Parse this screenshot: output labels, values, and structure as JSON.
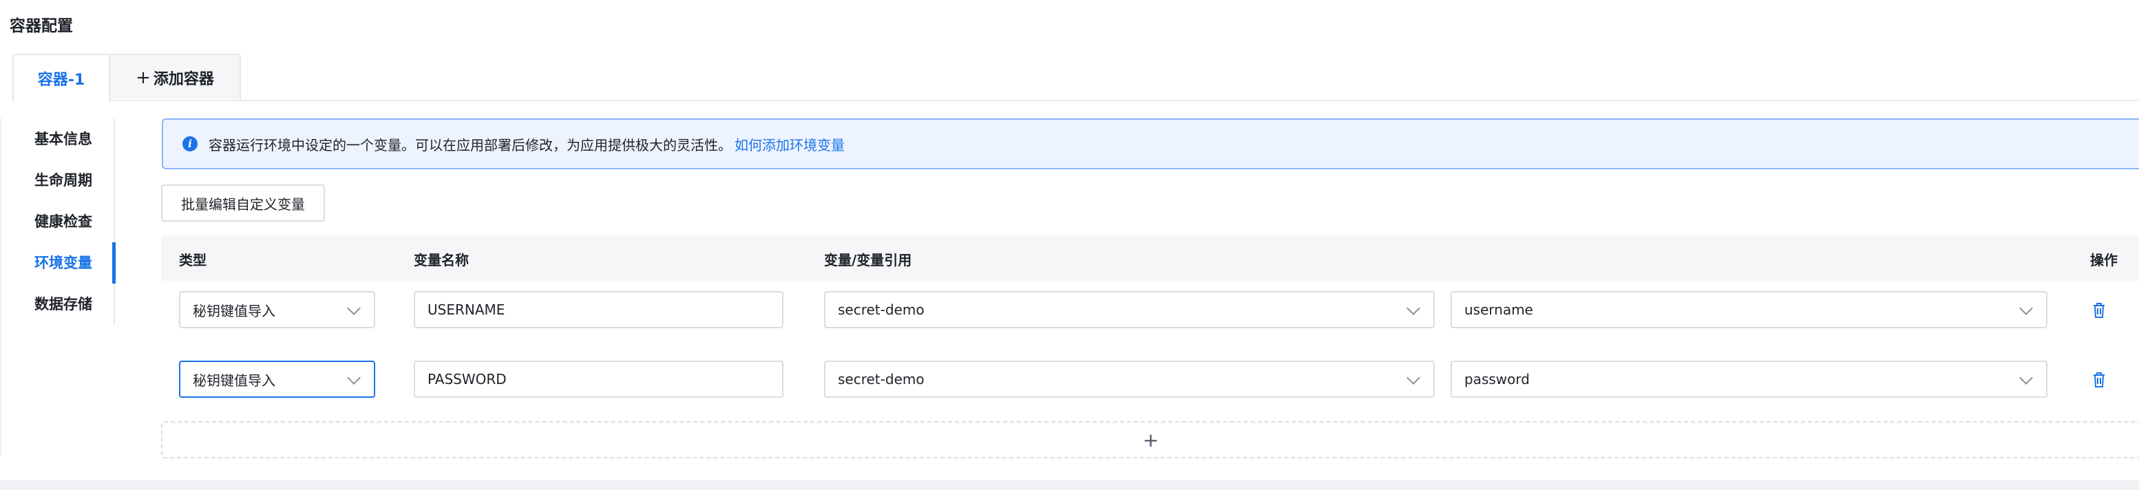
{
  "section_title": "容器配置",
  "tabs": [
    {
      "label": "容器-1"
    },
    {
      "plus": "+",
      "label": "添加容器"
    }
  ],
  "nav": {
    "items": [
      {
        "label": "基本信息"
      },
      {
        "label": "生命周期"
      },
      {
        "label": "健康检查"
      },
      {
        "label": "环境变量"
      },
      {
        "label": "数据存储"
      }
    ],
    "active_index": 3
  },
  "alert": {
    "icon": "info-icon",
    "text": "容器运行环境中设定的一个变量。可以在应用部署后修改，为应用提供极大的灵活性。",
    "link": "如何添加环境变量"
  },
  "batch_button": "批量编辑自定义变量",
  "table": {
    "headers": {
      "type": "类型",
      "name": "变量名称",
      "ref": "变量/变量引用",
      "action": "操作"
    },
    "rows": [
      {
        "type": "秘钥键值导入",
        "name": "USERNAME",
        "secret": "secret-demo",
        "key": "username"
      },
      {
        "type": "秘钥键值导入",
        "name": "PASSWORD",
        "secret": "secret-demo",
        "key": "password"
      }
    ]
  },
  "add_row": "+",
  "colors": {
    "accent": "#1a73e8",
    "alert_bg": "#edf4ff",
    "header_bg": "#f5f6f7"
  }
}
